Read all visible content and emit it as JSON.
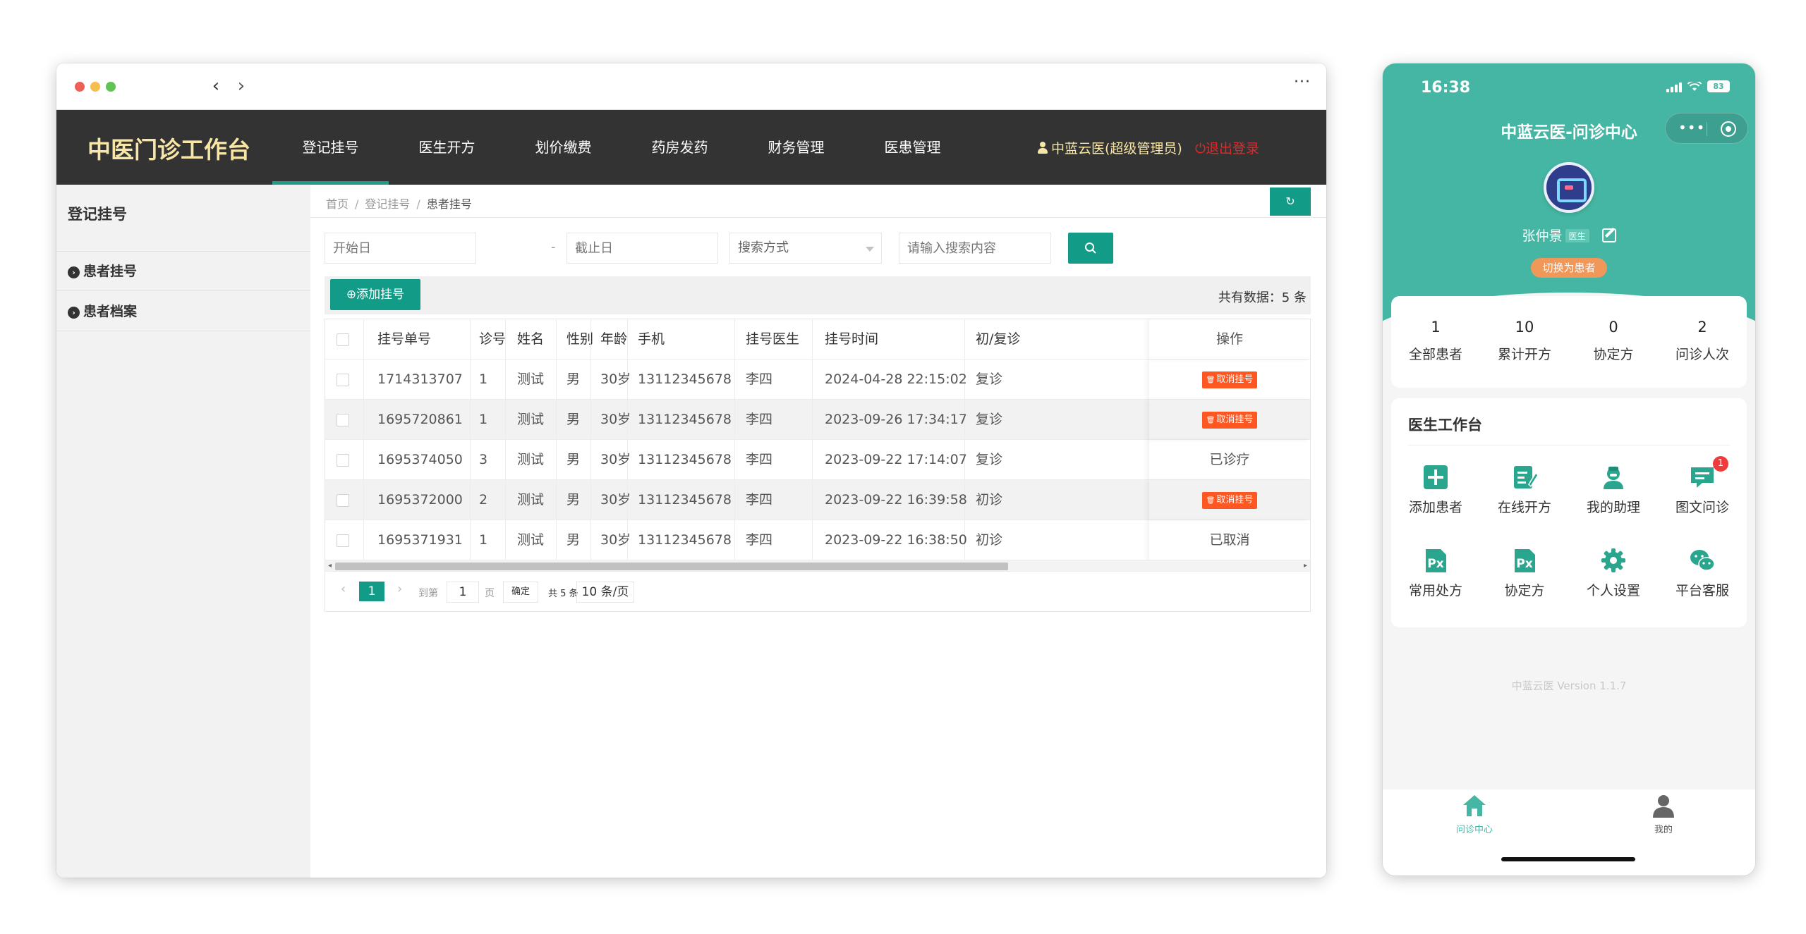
{
  "browser": {
    "more_label": "···"
  },
  "app": {
    "brand": "中医门诊工作台",
    "nav": [
      {
        "label": "登记挂号",
        "active": true
      },
      {
        "label": "医生开方"
      },
      {
        "label": "划价缴费"
      },
      {
        "label": "药房发药"
      },
      {
        "label": "财务管理"
      },
      {
        "label": "医患管理"
      }
    ],
    "user": "中蓝云医(超级管理员)",
    "logout": "退出登录"
  },
  "sidebar": {
    "title": "登记挂号",
    "items": [
      {
        "label": "患者挂号"
      },
      {
        "label": "患者档案"
      }
    ]
  },
  "breadcrumb": [
    "首页",
    "登记挂号",
    "患者挂号"
  ],
  "filters": {
    "start_placeholder": "开始日",
    "dash": "-",
    "end_placeholder": "截止日",
    "mode_placeholder": "搜索方式",
    "keyword_placeholder": "请输入搜索内容"
  },
  "toolbar": {
    "add_label": "添加挂号",
    "total_label": "共有数据：5 条"
  },
  "table": {
    "columns": [
      "挂号单号",
      "诊号",
      "姓名",
      "性别",
      "年龄",
      "手机",
      "挂号医生",
      "挂号时间",
      "初/复诊",
      "操作"
    ],
    "rows": [
      {
        "id": "1714313707",
        "no": "1",
        "name": "测试",
        "sex": "男",
        "age": "30岁",
        "phone": "13112345678",
        "doctor": "李四",
        "time": "2024-04-28 22:15:02",
        "visit": "复诊",
        "op": "取消挂号",
        "op_type": "button"
      },
      {
        "id": "1695720861",
        "no": "1",
        "name": "测试",
        "sex": "男",
        "age": "30岁",
        "phone": "13112345678",
        "doctor": "李四",
        "time": "2023-09-26 17:34:17",
        "visit": "复诊",
        "op": "取消挂号",
        "op_type": "button"
      },
      {
        "id": "1695374050",
        "no": "3",
        "name": "测试",
        "sex": "男",
        "age": "30岁",
        "phone": "13112345678",
        "doctor": "李四",
        "time": "2023-09-22 17:14:07",
        "visit": "复诊",
        "op": "已诊疗",
        "op_type": "text"
      },
      {
        "id": "1695372000",
        "no": "2",
        "name": "测试",
        "sex": "男",
        "age": "30岁",
        "phone": "13112345678",
        "doctor": "李四",
        "time": "2023-09-22 16:39:58",
        "visit": "初诊",
        "op": "取消挂号",
        "op_type": "button"
      },
      {
        "id": "1695371931",
        "no": "1",
        "name": "测试",
        "sex": "男",
        "age": "30岁",
        "phone": "13112345678",
        "doctor": "李四",
        "time": "2023-09-22 16:38:50",
        "visit": "初诊",
        "op": "已取消",
        "op_type": "text"
      }
    ]
  },
  "pager": {
    "current": "1",
    "goto_label": "到第",
    "goto_value": "1",
    "page_label": "页",
    "ok_label": "确定",
    "count_label": "共 5 条",
    "size_label": "10 条/页"
  },
  "phone": {
    "time": "16:38",
    "battery": "83",
    "title": "中蓝云医-问诊中心",
    "doctor_name": "张仲景",
    "role_badge": "医生",
    "switch_label": "切换为患者",
    "stats": [
      {
        "num": "1",
        "label": "全部患者"
      },
      {
        "num": "10",
        "label": "累计开方"
      },
      {
        "num": "0",
        "label": "协定方"
      },
      {
        "num": "2",
        "label": "问诊人次"
      }
    ],
    "work_title": "医生工作台",
    "tools": [
      {
        "label": "添加患者",
        "icon": "plus-square-icon"
      },
      {
        "label": "在线开方",
        "icon": "prescription-edit-icon"
      },
      {
        "label": "我的助理",
        "icon": "nurse-icon"
      },
      {
        "label": "图文问诊",
        "icon": "chat-icon",
        "badge": "1"
      },
      {
        "label": "常用处方",
        "icon": "rx-icon"
      },
      {
        "label": "协定方",
        "icon": "rx-icon"
      },
      {
        "label": "个人设置",
        "icon": "gear-icon"
      },
      {
        "label": "平台客服",
        "icon": "wechat-icon"
      }
    ],
    "version": "中蓝云医 Version 1.1.7",
    "tabbar": [
      {
        "label": "问诊中心",
        "active": true
      },
      {
        "label": "我的"
      }
    ],
    "accent": "#45b6a3"
  },
  "colors": {
    "primary": "#129b86",
    "danger": "#ff5722",
    "topbar": "#333333",
    "brand": "#f7e6a6"
  }
}
